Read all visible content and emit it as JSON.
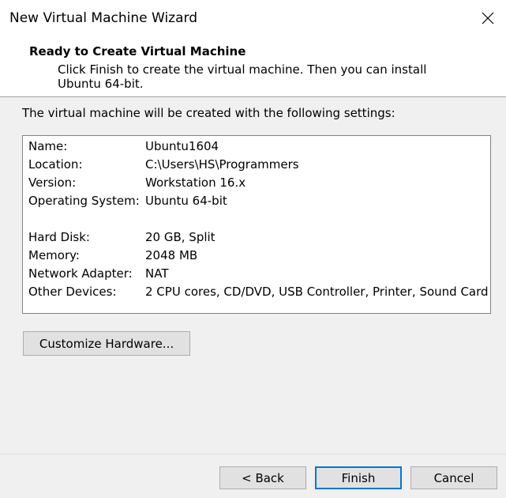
{
  "window": {
    "title": "New Virtual Machine Wizard"
  },
  "header": {
    "heading": "Ready to Create Virtual Machine",
    "description": "Click Finish to create the virtual machine. Then you can install Ubuntu 64-bit."
  },
  "intro_text": "The virtual machine will be created with the following settings:",
  "settings": [
    {
      "label": "Name:",
      "value": "Ubuntu1604"
    },
    {
      "label": "Location:",
      "value": "C:\\Users\\HS\\Programmers"
    },
    {
      "label": "Version:",
      "value": "Workstation 16.x"
    },
    {
      "label": "Operating System:",
      "value": "Ubuntu 64-bit"
    },
    {
      "label": "Hard Disk:",
      "value": "20 GB, Split"
    },
    {
      "label": "Memory:",
      "value": "2048 MB"
    },
    {
      "label": "Network Adapter:",
      "value": "NAT"
    },
    {
      "label": "Other Devices:",
      "value": "2 CPU cores, CD/DVD, USB Controller, Printer, Sound Card"
    }
  ],
  "buttons": {
    "customize": "Customize Hardware...",
    "back": "< Back",
    "finish": "Finish",
    "cancel": "Cancel"
  },
  "icons": {
    "close": "close-icon"
  }
}
